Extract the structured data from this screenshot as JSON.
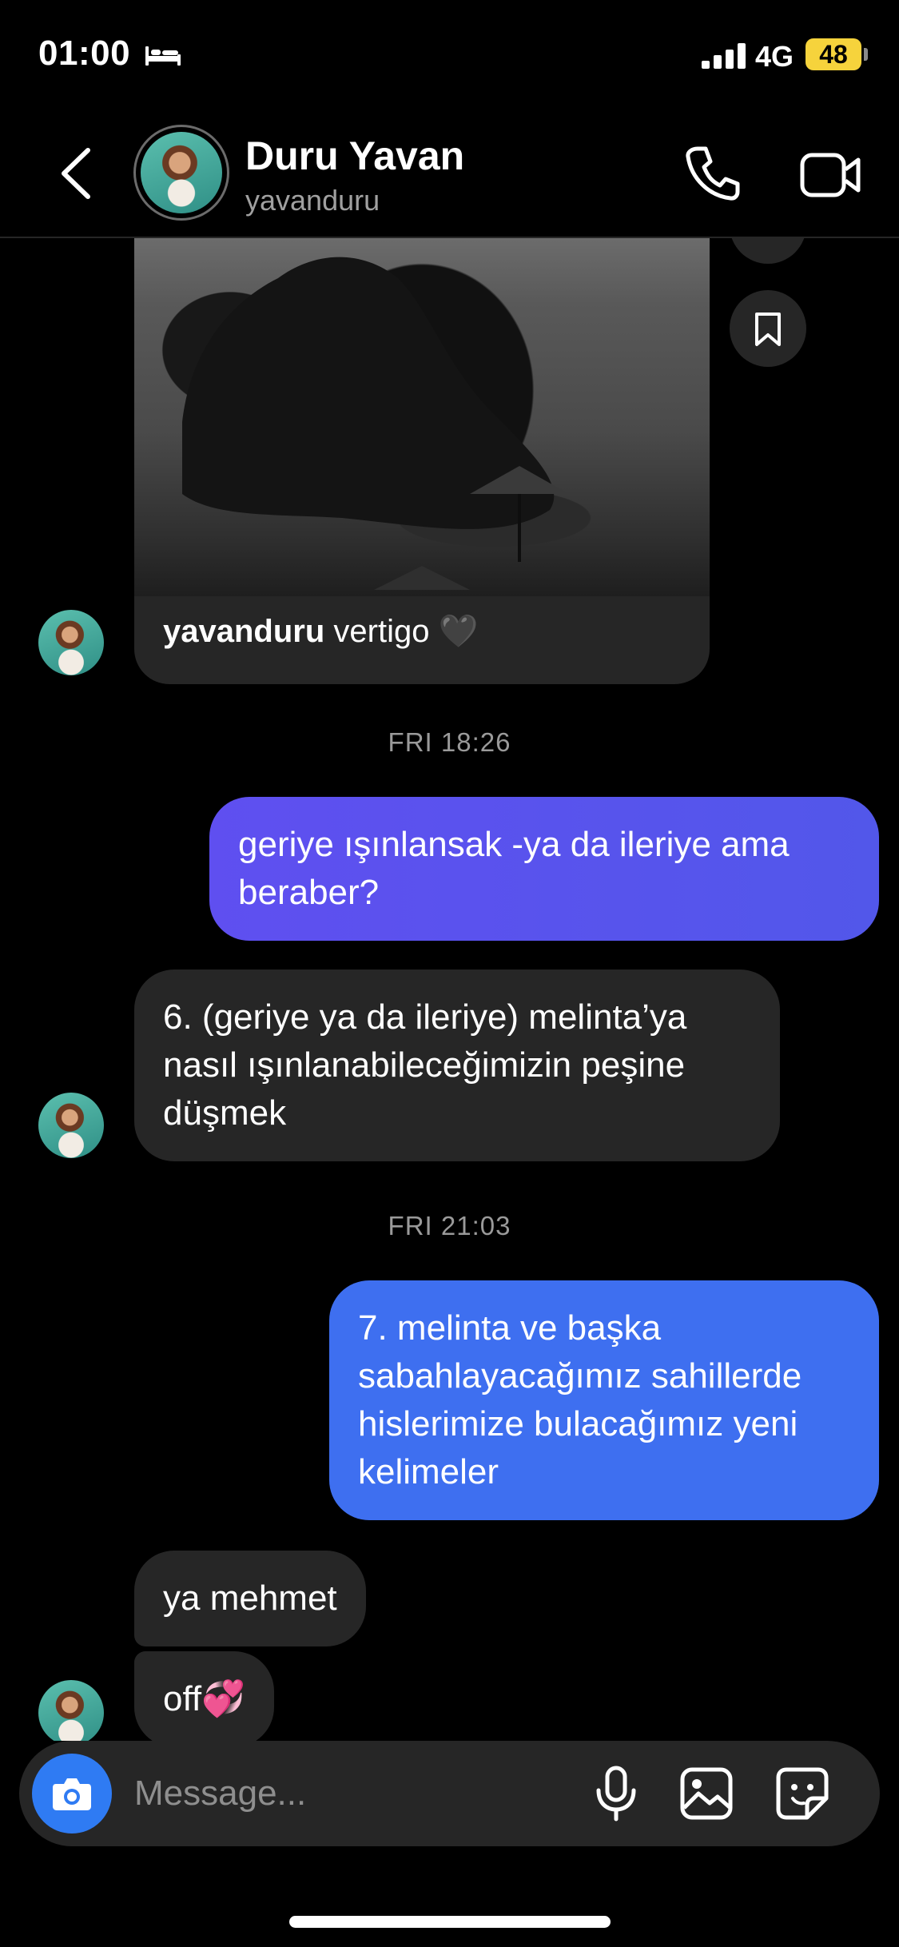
{
  "status_bar": {
    "time": "01:00",
    "network": "4G",
    "battery": "48"
  },
  "header": {
    "name": "Duru Yavan",
    "handle": "yavanduru"
  },
  "shared_post": {
    "username": "yavanduru",
    "caption": " vertigo 🖤"
  },
  "messages": [
    {
      "type": "timestamp",
      "text": "FRI 18:26"
    },
    {
      "type": "outgoing",
      "text": "geriye ışınlansak -ya da ileriye ama beraber?"
    },
    {
      "type": "incoming",
      "text": "6. (geriye ya da ileriye) melinta’ya nasıl ışınlanabileceğimizin peşine düşmek"
    },
    {
      "type": "timestamp",
      "text": "FRI 21:03"
    },
    {
      "type": "outgoing",
      "text": "7. melinta ve başka sabahlayacağımız sahillerde hislerimize bulacağımız yeni kelimeler"
    },
    {
      "type": "incoming",
      "text": "ya mehmet"
    },
    {
      "type": "incoming",
      "text": "off💞"
    }
  ],
  "composer": {
    "placeholder": "Message..."
  },
  "colors": {
    "background": "#000000",
    "incoming_bubble": "#262626",
    "outgoing_bubble_1": "#5b52ee",
    "outgoing_bubble_2": "#3e6ff0",
    "camera_button": "#2f7bf3",
    "battery": "#f6d33c"
  },
  "icons": [
    "bed-icon",
    "signal-icon",
    "back-icon",
    "phone-icon",
    "video-call-icon",
    "bookmark-icon",
    "camera-icon",
    "microphone-icon",
    "gallery-icon",
    "sticker-icon"
  ]
}
